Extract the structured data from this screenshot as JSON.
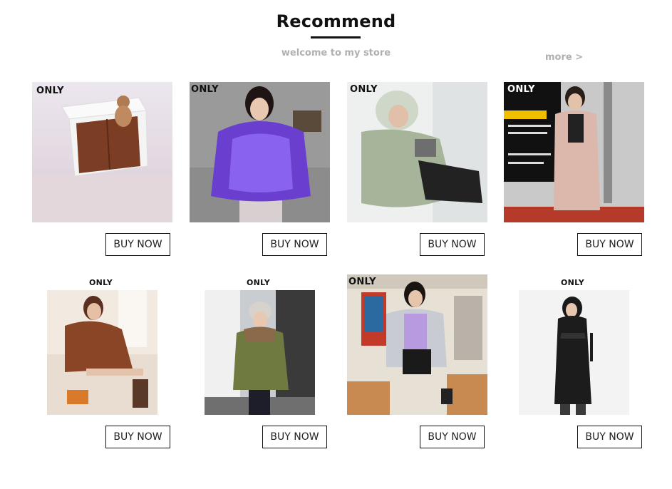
{
  "header": {
    "title": "Recommend",
    "subtitle": "welcome to my store",
    "more_label": "more >"
  },
  "brand": "ONLY",
  "products": [
    {
      "buy_label": "BUY NOW",
      "image": "chocolate-puffer-with-teddy-bear-in-box"
    },
    {
      "buy_label": "BUY NOW",
      "image": "purple-metallic-puffer-jacket"
    },
    {
      "buy_label": "BUY NOW",
      "image": "sage-fur-hood-puffer-coat"
    },
    {
      "buy_label": "BUY NOW",
      "image": "blush-long-belted-down-coat"
    },
    {
      "buy_label": "BUY NOW",
      "image": "brown-teddy-coat-on-chair"
    },
    {
      "buy_label": "BUY NOW",
      "image": "olive-parka-with-fur-collar"
    },
    {
      "buy_label": "BUY NOW",
      "image": "silver-metallic-puffer-jacket"
    },
    {
      "buy_label": "BUY NOW",
      "image": "black-long-hooded-down-coat"
    }
  ],
  "colors": {
    "title": "#111111",
    "subtitle": "#b0b0b0",
    "button_border": "#111111"
  }
}
